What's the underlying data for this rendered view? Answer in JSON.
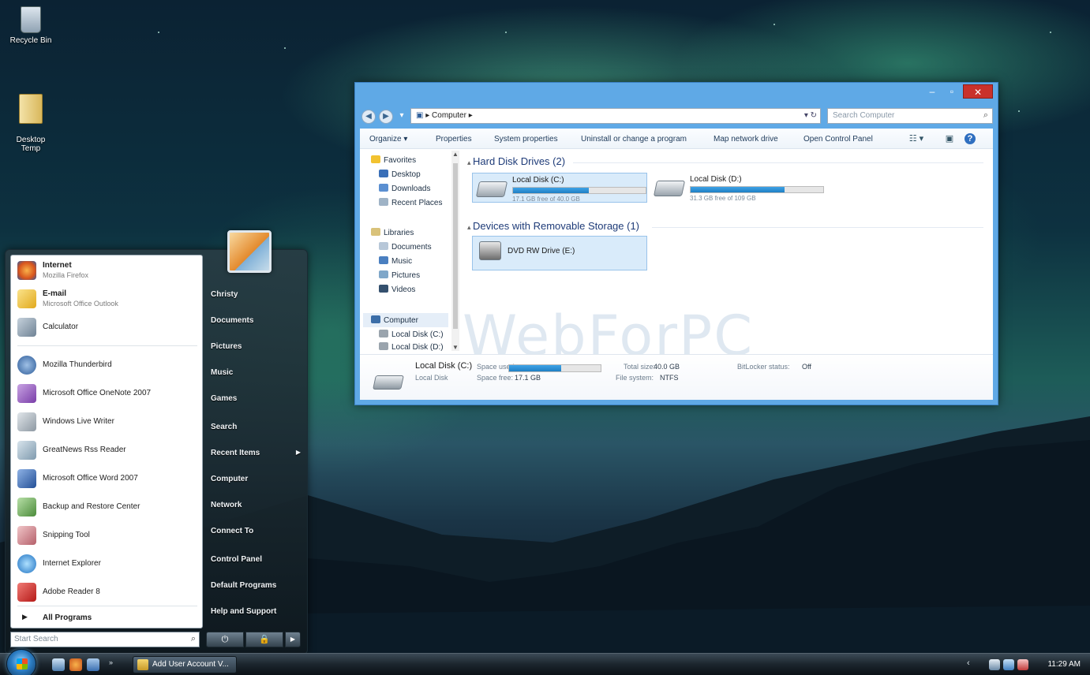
{
  "desktop": {
    "icons": [
      {
        "label": "Recycle Bin",
        "icon": "recycle-bin-icon"
      },
      {
        "label": "Desktop\nTemp",
        "icon": "folder-icon"
      }
    ],
    "watermark": "WebForPC"
  },
  "explorer": {
    "window_buttons": {
      "minimize": "–",
      "maximize": "▫",
      "close": "✕"
    },
    "nav": {
      "back": "◀",
      "forward": "▶",
      "history": "▾"
    },
    "address": {
      "path": "Computer",
      "separator": "▸",
      "controls": "▾  ↻"
    },
    "search": {
      "placeholder": "Search Computer",
      "icon": "⌕"
    },
    "toolbar": {
      "organize": "Organize ▾",
      "properties": "Properties",
      "system_properties": "System properties",
      "uninstall": "Uninstall or change a program",
      "map_network": "Map network drive",
      "open_control_panel": "Open Control Panel",
      "view_icon": "☷ ▾",
      "preview_icon": "▣",
      "help_icon": "?"
    },
    "navpane": {
      "favorites": "Favorites",
      "desktop": "Desktop",
      "downloads": "Downloads",
      "recent_places": "Recent Places",
      "libraries": "Libraries",
      "documents": "Documents",
      "music": "Music",
      "pictures": "Pictures",
      "videos": "Videos",
      "computer": "Computer",
      "local_c": "Local Disk (C:)",
      "local_d": "Local Disk (D:)"
    },
    "groups": {
      "hard_disks": "Hard Disk Drives (2)",
      "removable": "Devices with Removable Storage (1)"
    },
    "drives": [
      {
        "name": "Local Disk (C:)",
        "free_text": "17.1 GB free of 40.0 GB",
        "used_fraction": 0.57,
        "selected": true
      },
      {
        "name": "Local Disk (D:)",
        "free_text": "31.3 GB free of 109 GB",
        "used_fraction": 0.71,
        "selected": false
      }
    ],
    "dvd": {
      "name": "DVD RW Drive (E:)"
    },
    "details": {
      "name": "Local Disk (C:)",
      "type": "Local Disk",
      "space_used_label": "Space used:",
      "space_used_fraction": 0.57,
      "space_free_label": "Space free:",
      "space_free_value": "17.1 GB",
      "total_size_label": "Total size:",
      "total_size_value": "40.0 GB",
      "file_system_label": "File system:",
      "file_system_value": "NTFS",
      "bitlocker_label": "BitLocker status:",
      "bitlocker_value": "Off"
    }
  },
  "start_menu": {
    "pinned": [
      {
        "title": "Internet",
        "sub": "Mozilla Firefox",
        "icon": "firefox-icon",
        "color": "#e8762a"
      },
      {
        "title": "E-mail",
        "sub": "Microsoft Office Outlook",
        "icon": "outlook-icon",
        "color": "#f2c84b"
      }
    ],
    "recent": [
      {
        "label": "Calculator",
        "icon": "calculator-icon",
        "color": "#8fa3b5"
      },
      {
        "label": "Mozilla Thunderbird",
        "icon": "thunderbird-icon",
        "color": "#3f6fa8"
      },
      {
        "label": "Microsoft Office OneNote 2007",
        "icon": "onenote-icon",
        "color": "#8a4fb5"
      },
      {
        "label": "Windows Live Writer",
        "icon": "live-writer-icon",
        "color": "#9aa6b0"
      },
      {
        "label": "GreatNews Rss Reader",
        "icon": "rss-reader-icon",
        "color": "#a3b9c9"
      },
      {
        "label": "Microsoft Office Word 2007",
        "icon": "word-icon",
        "color": "#2f5fa8"
      },
      {
        "label": "Backup and Restore Center",
        "icon": "backup-icon",
        "color": "#5c9f4a"
      },
      {
        "label": "Snipping Tool",
        "icon": "snipping-tool-icon",
        "color": "#c9787e"
      },
      {
        "label": "Internet Explorer",
        "icon": "internet-explorer-icon",
        "color": "#2e86d3"
      },
      {
        "label": "Adobe Reader 8",
        "icon": "adobe-reader-icon",
        "color": "#c8211f"
      }
    ],
    "all_programs": "All Programs",
    "all_programs_arrow": "▶",
    "right_items": [
      {
        "label": "Christy",
        "name": "start-user-christy"
      },
      {
        "label": "Documents",
        "name": "start-documents"
      },
      {
        "label": "Pictures",
        "name": "start-pictures"
      },
      {
        "label": "Music",
        "name": "start-music"
      },
      {
        "label": "Games",
        "name": "start-games"
      },
      {
        "label": "Search",
        "name": "start-search-link"
      },
      {
        "label": "Recent Items",
        "name": "start-recent-items"
      },
      {
        "label": "Computer",
        "name": "start-computer"
      },
      {
        "label": "Network",
        "name": "start-network"
      },
      {
        "label": "Connect To",
        "name": "start-connect-to"
      },
      {
        "label": "Control Panel",
        "name": "start-control-panel"
      },
      {
        "label": "Default Programs",
        "name": "start-default-programs"
      },
      {
        "label": "Help and Support",
        "name": "start-help-support"
      }
    ],
    "search_placeholder": "Start Search",
    "search_icon": "⌕",
    "power": {
      "power_icon": "⏻",
      "lock_icon": "🔒",
      "more_icon": "▶"
    }
  },
  "taskbar": {
    "task": "Add User Account V...",
    "tray_arrow": "‹",
    "clock": "11:29 AM"
  }
}
